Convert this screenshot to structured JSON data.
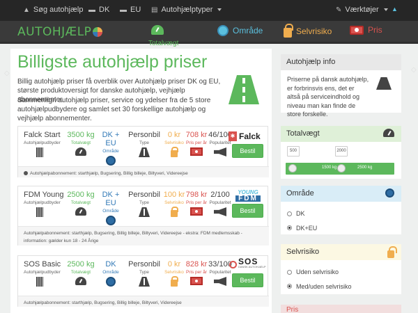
{
  "topbar": {
    "search_label": "Søg autohjælp",
    "dk_label": "DK",
    "eu_label": "EU",
    "types_label": "Autohjælptyper",
    "tools_label": "Værktøjer"
  },
  "header": {
    "logo_text": "AUTOHJÆLP",
    "nav": {
      "weight": "Totalvægt",
      "area": "Område",
      "deductible": "Selvrisiko",
      "price": "Pris"
    }
  },
  "main": {
    "title": "Billigste autohjælp priser",
    "intro_1": "Billig autohjælp priser få overblik over Autohjælp priser DK og EU, største produktoversigt for danske autohjælp, vejhjælp abonnementer.",
    "intro_2": "Sammenlign autohjælp priser, service og ydelser fra de 5 store autohjælpudbydere og samlet set 30 forskellige autohjælp og vejhjælp abonnementer."
  },
  "column_labels": {
    "provider": "Autohjælpudbyder",
    "weight": "Totalvægt",
    "area": "Område",
    "type": "Type",
    "deductible": "Selvrisiko",
    "price": "Pris per år",
    "popularity": "Popularitet",
    "order": "Bestil"
  },
  "offers": [
    {
      "name": "Falck Start",
      "weight": "3500 kg",
      "area_1": "DK +",
      "area_2": "EU",
      "type": "Personbil",
      "deductible": "0 kr",
      "price": "708 kr",
      "popularity": "46/100",
      "logo": "Falck",
      "note": "Autohjælpabonnement: starthjælp, Bugsering, Billig billeje, Biltyveri, Videreejse"
    },
    {
      "name": "FDM Young",
      "weight": "2500 kg",
      "area_1": "DK +",
      "area_2": "EU",
      "type": "Personbil",
      "deductible": "100 kr",
      "price": "798 kr",
      "popularity": "2/100",
      "logo_1": "YOUNG",
      "logo_2": "FDM",
      "note": "Autohjælpabonnement: starthjælp, Bugsering, Billig billeje, Biltyveri, Videreejse - ekstra: FDM medlemsskab - information: gælder kun 18 - 24 Årige"
    },
    {
      "name": "SOS Basic",
      "weight": "2500 kg",
      "area_1": "DK",
      "area_2": "",
      "type": "Personbil",
      "deductible": "0 kr",
      "price": "828 kr",
      "popularity": "33/100",
      "logo": "SOS",
      "logo_sub": "DANSK AUTOHJÆLP",
      "note": "Autohjælpabonnement: starthjælp, Bugsering, Billig billeje, Biltyveri, Videreejse"
    }
  ],
  "sidebar": {
    "info_title": "Autohjælp info",
    "info_text": "Priserne på dansk autohjælp, er forbrinsvis ens, det er altså på serviceindhold og niveau man kan finde de store forskelle.",
    "weight_title": "Totalvægt",
    "weight_min": "500",
    "weight_max": "2000",
    "slider_low": "1500 kg",
    "slider_high": "2500 kg",
    "slider_low_kg": 1500,
    "slider_high_kg": 2500,
    "area_title": "Område",
    "area_options": [
      "DK",
      "DK+EU"
    ],
    "area_selected": "DK+EU",
    "deductible_title": "Selvrisiko",
    "deductible_options": [
      "Uden selvrisiko",
      "Med/uden selvrisiko"
    ],
    "deductible_selected": "Med/uden selvrisiko",
    "price_title": "Pris"
  },
  "colors": {
    "brand_green": "#5cb85c",
    "blue": "#337ab7",
    "orange": "#f0ad4e",
    "red": "#d9534f",
    "topbar": "#262626"
  }
}
